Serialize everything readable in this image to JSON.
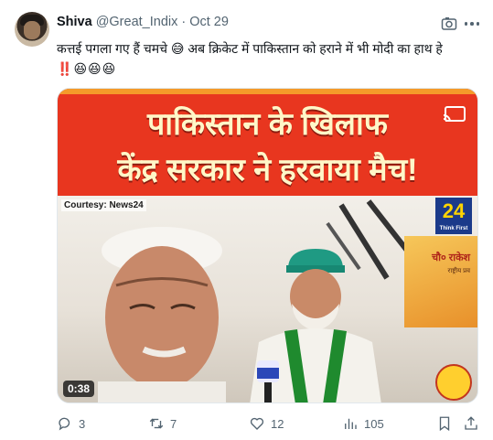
{
  "author": {
    "name": "Shiva",
    "handle": "@Great_Indix",
    "separator": "·",
    "date": "Oct 29"
  },
  "tweet": {
    "line1": "कत्तई पगला गए हैं चमचे 😅 अब क्रिकेट में पाकिस्तान को हराने में भी मोदी का हाथ हे",
    "line2_bang": "‼️",
    "line2_emojis": "😆😆😆"
  },
  "media": {
    "banner_line1": "पाकिस्तान के खिलाफ",
    "banner_line2": "केंद्र सरकार ने हरवाया मैच!",
    "courtesy": "Courtesy: News24",
    "channel_logo": "24",
    "channel_tagline": "Think First",
    "poster_name": "चौ० राकेश",
    "poster_sub": "राष्ट्रीय प्रव",
    "duration": "0:38",
    "colors": {
      "banner": "#e8361f",
      "banner_text": "#fff7c8"
    }
  },
  "actions": {
    "replies": "3",
    "retweets": "7",
    "likes": "12",
    "views": "105"
  },
  "icons": [
    "grok-icon",
    "more-icon",
    "cast-icon",
    "reply-icon",
    "retweet-icon",
    "like-icon",
    "views-icon",
    "bookmark-icon",
    "share-icon"
  ]
}
